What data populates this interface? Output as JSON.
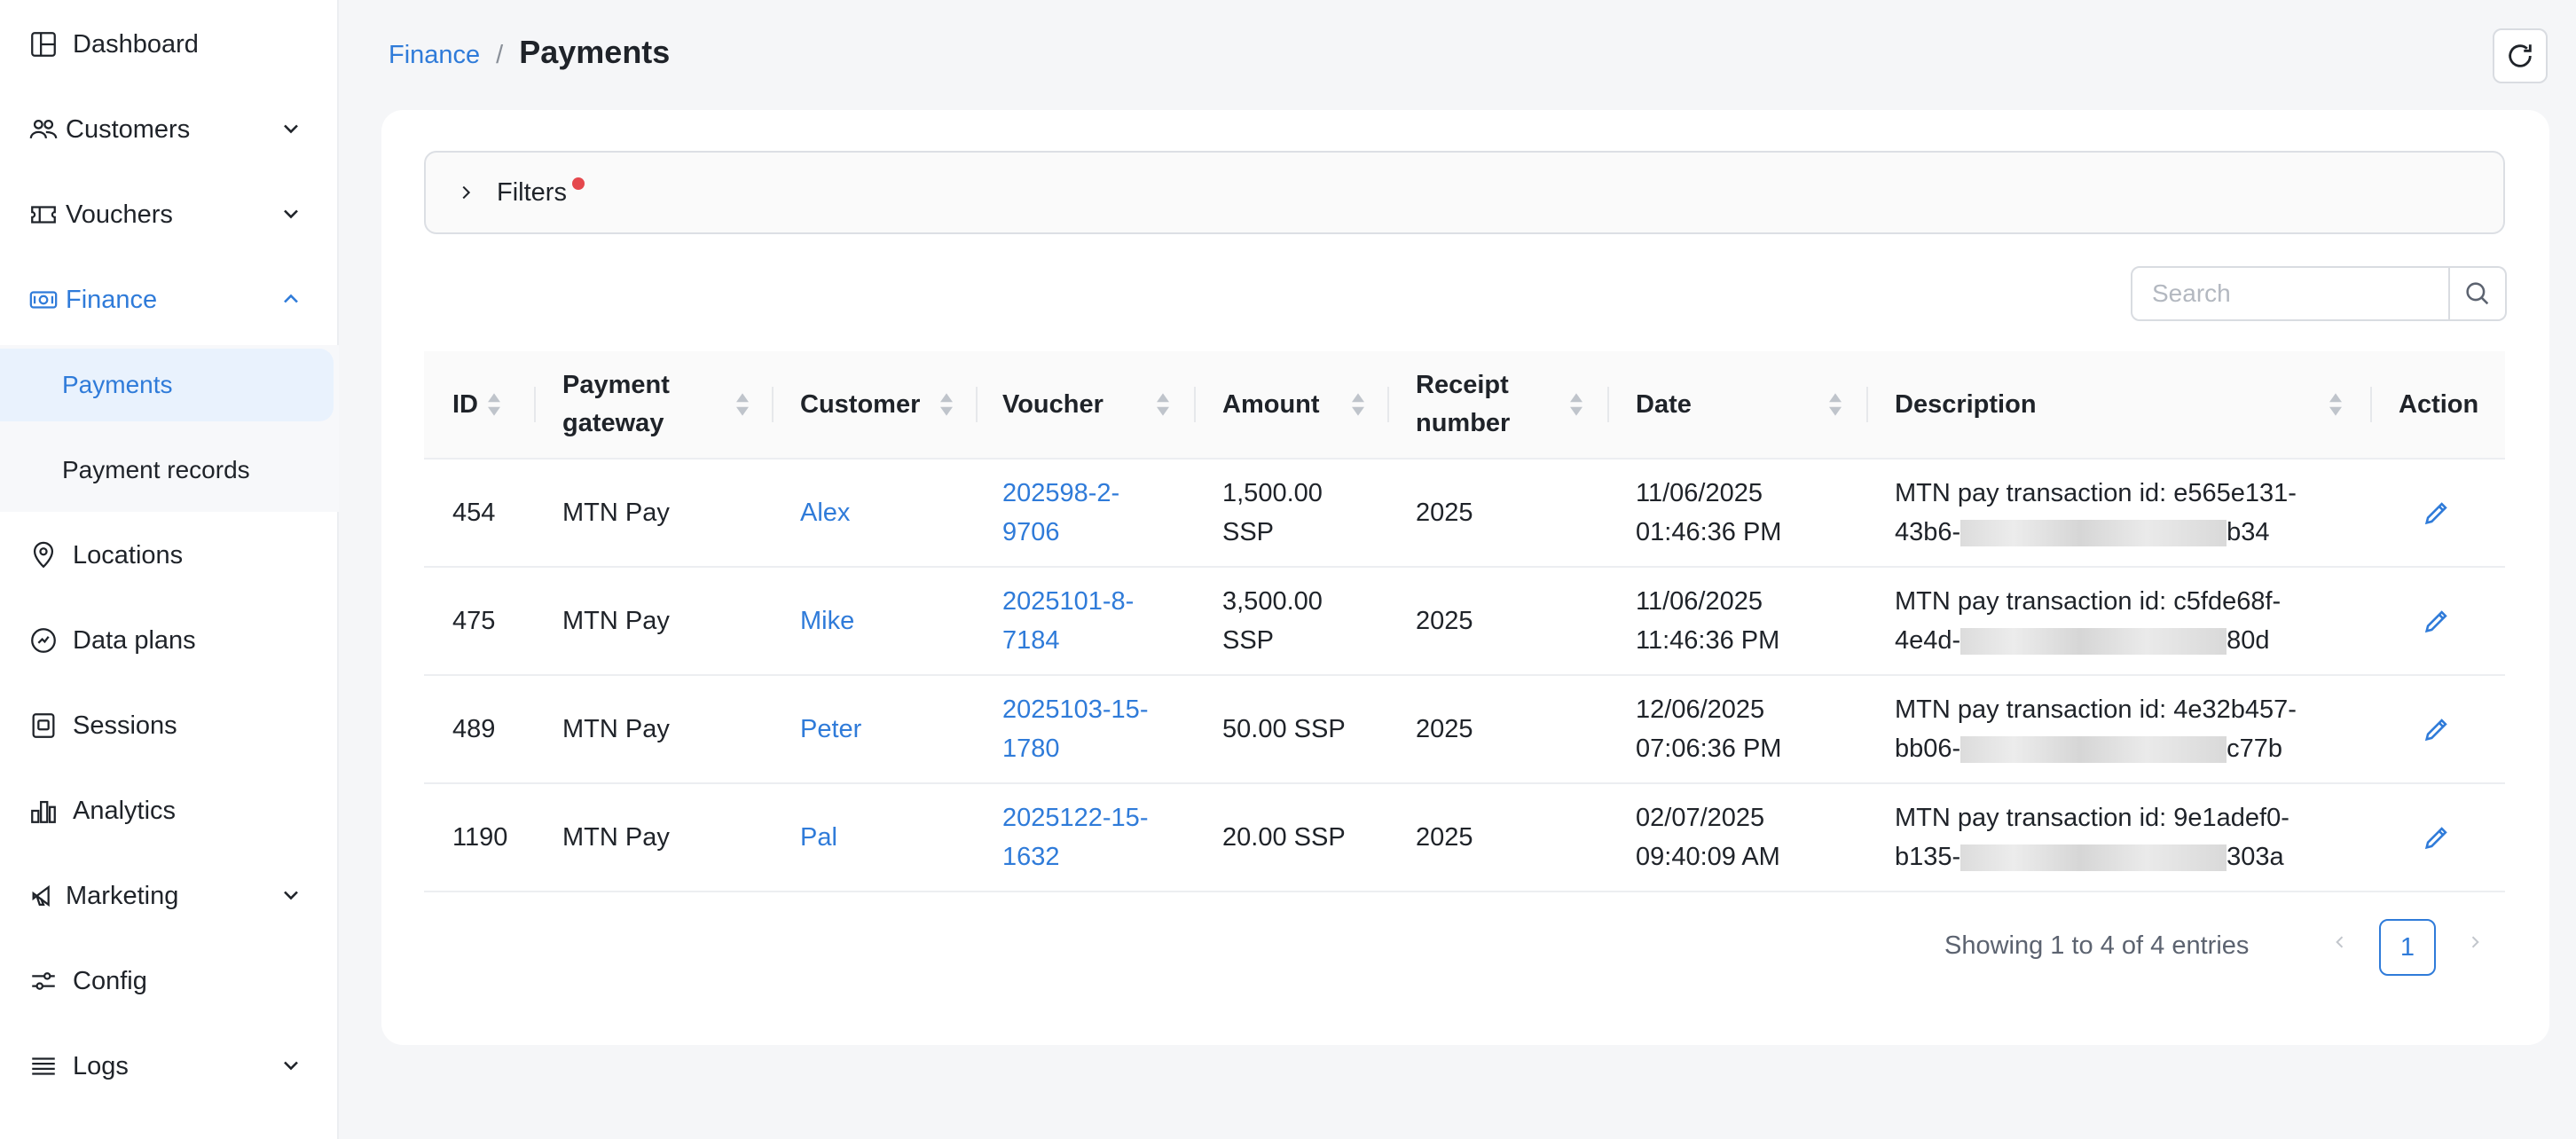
{
  "sidebar": {
    "items": [
      {
        "label": "Dashboard",
        "icon": "dashboard-icon"
      },
      {
        "label": "Customers",
        "icon": "customers-icon"
      },
      {
        "label": "Vouchers",
        "icon": "voucher-icon"
      },
      {
        "label": "Finance",
        "icon": "finance-icon"
      },
      {
        "label": "Payments"
      },
      {
        "label": "Payment records"
      },
      {
        "label": "Locations",
        "icon": "location-pin-icon"
      },
      {
        "label": "Data plans",
        "icon": "data-plans-icon"
      },
      {
        "label": "Sessions",
        "icon": "sessions-icon"
      },
      {
        "label": "Analytics",
        "icon": "analytics-icon"
      },
      {
        "label": "Marketing",
        "icon": "megaphone-icon"
      },
      {
        "label": "Config",
        "icon": "sliders-icon"
      },
      {
        "label": "Logs",
        "icon": "logs-icon"
      }
    ]
  },
  "header": {
    "breadcrumb_parent": "Finance",
    "breadcrumb_sep": "/",
    "title": "Payments"
  },
  "filters": {
    "label": "Filters"
  },
  "search": {
    "placeholder": "Search",
    "value": ""
  },
  "table": {
    "columns": {
      "id": "ID",
      "gateway_line1": "Payment",
      "gateway_line2": "gateway",
      "customer": "Customer",
      "voucher": "Voucher",
      "amount": "Amount",
      "receipt_line1": "Receipt",
      "receipt_line2": "number",
      "date": "Date",
      "description": "Description",
      "action": "Action"
    },
    "rows": [
      {
        "id": "454",
        "gateway": "MTN Pay",
        "customer": "Alex",
        "voucher_1": "202598-2-",
        "voucher_2": "9706",
        "amount_1": "1,500.00",
        "amount_2": "SSP",
        "receipt": "2025",
        "date_1": "11/06/2025",
        "date_2": "01:46:36 PM",
        "desc_1": "MTN pay transaction id: e565e131-",
        "desc_2a": "43b6-",
        "desc_2b": "b34"
      },
      {
        "id": "475",
        "gateway": "MTN Pay",
        "customer": "Mike",
        "voucher_1": "2025101-8-",
        "voucher_2": "7184",
        "amount_1": "3,500.00",
        "amount_2": "SSP",
        "receipt": "2025",
        "date_1": "11/06/2025",
        "date_2": "11:46:36 PM",
        "desc_1": "MTN pay transaction id: c5fde68f-",
        "desc_2a": "4e4d-",
        "desc_2b": "80d"
      },
      {
        "id": "489",
        "gateway": "MTN Pay",
        "customer": "Peter",
        "voucher_1": "2025103-15-",
        "voucher_2": "1780",
        "amount_1": "50.00 SSP",
        "amount_2": "",
        "receipt": "2025",
        "date_1": "12/06/2025",
        "date_2": "07:06:36 PM",
        "desc_1": "MTN pay transaction id: 4e32b457-",
        "desc_2a": "bb06-",
        "desc_2b": "c77b"
      },
      {
        "id": "1190",
        "gateway": "MTN Pay",
        "customer": "Pal",
        "voucher_1": "2025122-15-",
        "voucher_2": "1632",
        "amount_1": "20.00 SSP",
        "amount_2": "",
        "receipt": "2025",
        "date_1": "02/07/2025",
        "date_2": "09:40:09 AM",
        "desc_1": "MTN pay transaction id: 9e1adef0-",
        "desc_2a": "b135-",
        "desc_2b": "303a"
      }
    ]
  },
  "pagination": {
    "showing": "Showing 1 to 4 of 4 entries",
    "current_page": "1"
  },
  "colors": {
    "accent": "#2f7bd9",
    "filter_dot": "#e5484d"
  }
}
